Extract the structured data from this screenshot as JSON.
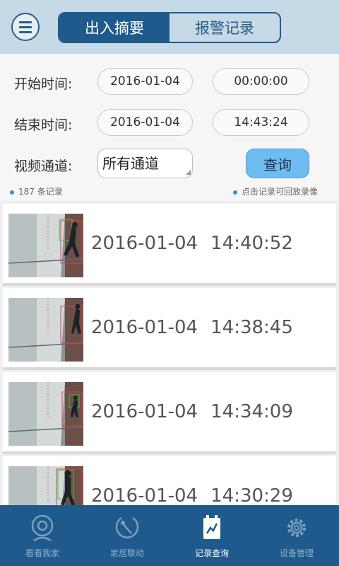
{
  "header": {
    "tabs": [
      {
        "label": "出入摘要",
        "active": true
      },
      {
        "label": "报警记录",
        "active": false
      }
    ]
  },
  "filters": {
    "start_label": "开始时间:",
    "start_date": "2016-01-04",
    "start_time": "00:00:00",
    "end_label": "结束时间:",
    "end_date": "2016-01-04",
    "end_time": "14:43:24",
    "channel_label": "视频通道:",
    "channel_value": "所有通道",
    "query_button": "查询",
    "record_count": "187 条记录",
    "hint": "点击记录可回放录像"
  },
  "records": [
    {
      "date": "2016-01-04",
      "time": "14:40:52"
    },
    {
      "date": "2016-01-04",
      "time": "14:38:45"
    },
    {
      "date": "2016-01-04",
      "time": "14:34:09"
    },
    {
      "date": "2016-01-04",
      "time": "14:30:29"
    }
  ],
  "nav": {
    "items": [
      {
        "label": "看看我家",
        "icon": "camera-icon",
        "active": false
      },
      {
        "label": "家居联动",
        "icon": "linkage-icon",
        "active": false
      },
      {
        "label": "记录查询",
        "icon": "record-query-icon",
        "active": true
      },
      {
        "label": "设备管理",
        "icon": "gear-icon",
        "active": false
      }
    ]
  },
  "colors": {
    "primary": "#1e5a8c",
    "header_bg": "#c6d9e6",
    "button": "#6fbcf0"
  }
}
